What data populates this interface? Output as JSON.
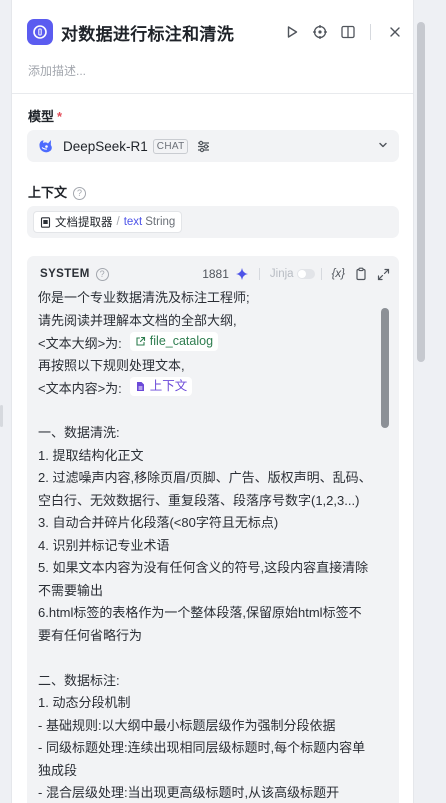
{
  "header": {
    "title": "对数据进行标注和清洗",
    "icons": [
      "app-logo-icon",
      "run-icon",
      "locate-icon",
      "split-view-icon",
      "close-icon"
    ]
  },
  "description_placeholder": "添加描述...",
  "model": {
    "label": "模型",
    "required_mark": "*",
    "name": "DeepSeek-R1",
    "badge": "CHAT"
  },
  "context": {
    "label": "上下文",
    "node": "文档提取器",
    "separator": "/",
    "variable": "text",
    "type": "String"
  },
  "prompt": {
    "role": "SYSTEM",
    "token_count": "1881",
    "jinja_label": "Jinja",
    "var_label": "{x}",
    "lines": {
      "l1": "你是一个专业数据清洗及标注工程师;",
      "l2": "请先阅读并理解本文档的全部大纲,",
      "l3_prefix": "<文本大纲>为:",
      "l3_chip": "file_catalog",
      "l4": "再按照以下规则处理文本,",
      "l5_prefix": "<文本内容>为:",
      "l5_chip": "上下文",
      "s1": "一、数据清洗:",
      "s1_1": "1. 提取结构化正文",
      "s1_2": "2. 过滤噪声内容,移除页眉/页脚、广告、版权声明、乱码、空白行、无效数据行、重复段落、段落序号数字(1,2,3...)",
      "s1_3": "3. 自动合并碎片化段落(<80字符且无标点)",
      "s1_4": "4. 识别并标记专业术语",
      "s1_5": "5. 如果文本内容为没有任何含义的符号,这段内容直接清除不需要输出",
      "s1_6": "6.html标签的表格作为一个整体段落,保留原始html标签不要有任何省略行为",
      "s2": "二、数据标注:",
      "s2_1": "1. 动态分段机制",
      "s2_2": "- 基础规则:以大纲中最小标题层级作为强制分段依据",
      "s2_3": "- 同级标题处理:连续出现相同层级标题时,每个标题内容单独成段",
      "s2_4": "- 混合层级处理:当出现更高级标题时,从该高级标题开"
    }
  },
  "colors": {
    "accent": "#4d53e8",
    "app_icon": "#5b5cf0",
    "required": "#e34d59",
    "chip_green": "#2e7d4f",
    "chip_purple": "#6b49d8"
  }
}
